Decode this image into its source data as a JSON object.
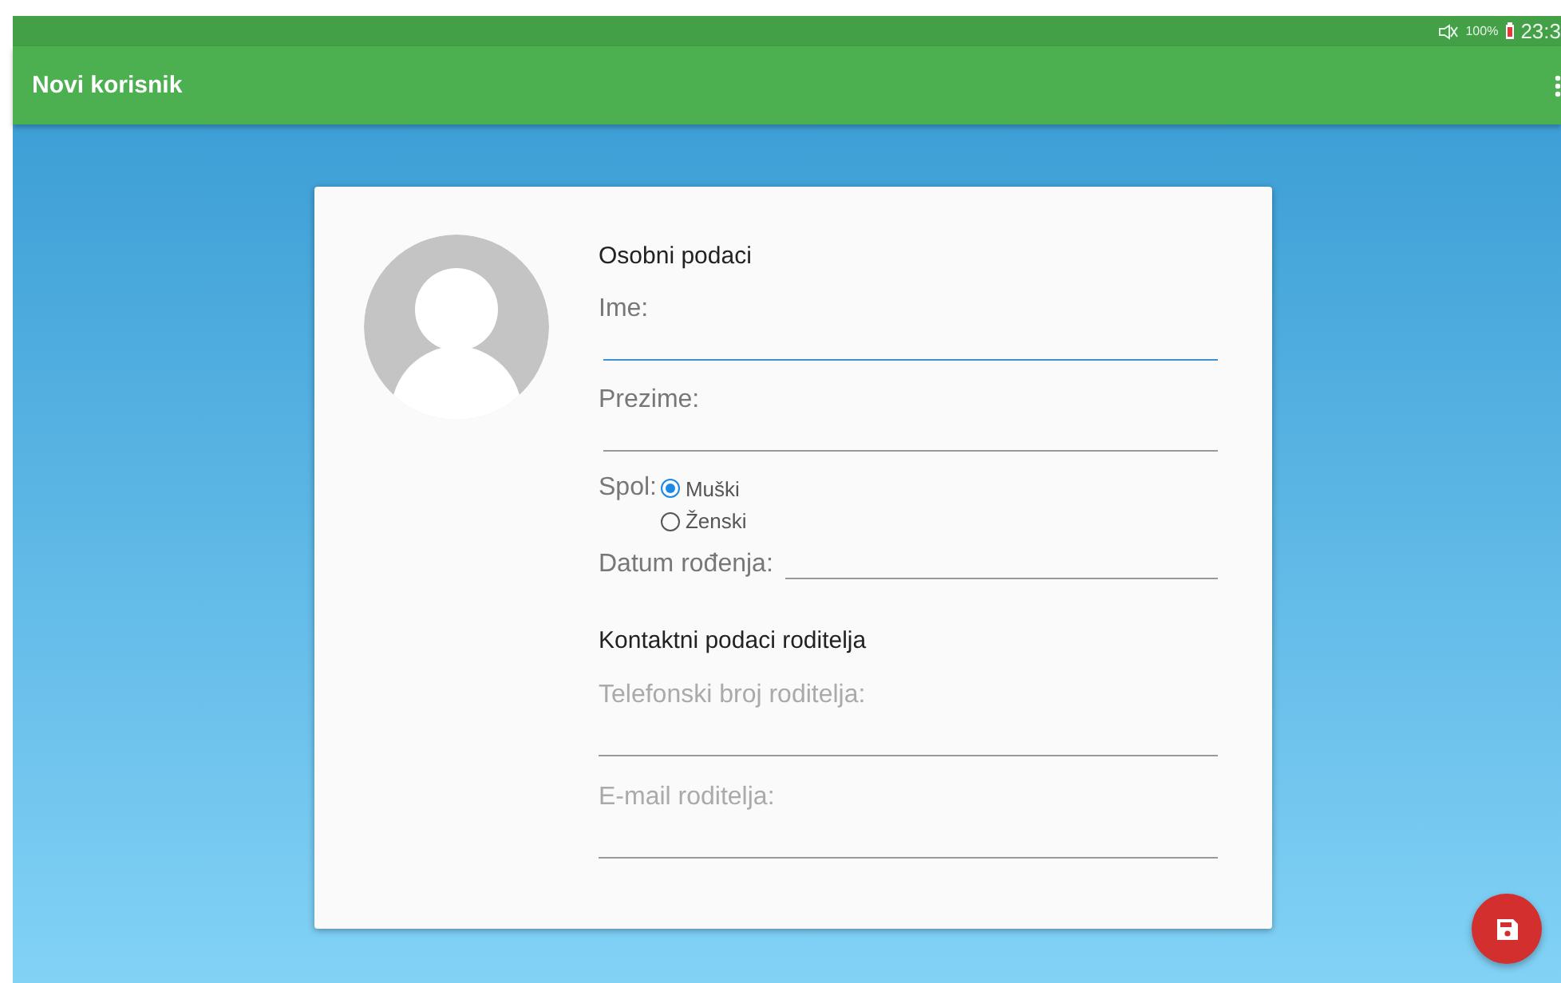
{
  "status_bar": {
    "battery": "100%",
    "time": "23:3"
  },
  "app_bar": {
    "title": "Novi korisnik"
  },
  "personal": {
    "heading": "Osobni podaci",
    "fields": [
      {
        "label": "Ime:",
        "focused": true
      },
      {
        "label": "Prezime:",
        "focused": false
      }
    ],
    "gender": {
      "label": "Spol:",
      "options": [
        {
          "label": "Muški",
          "selected": true
        },
        {
          "label": "Ženski",
          "selected": false
        }
      ]
    },
    "birth_date": {
      "label": "Datum rođenja:"
    }
  },
  "contact": {
    "heading": "Kontaktni podaci roditelja",
    "fields": [
      {
        "placeholder": "Telefonski broj roditelja:"
      },
      {
        "placeholder": "E-mail roditelja:"
      }
    ]
  }
}
